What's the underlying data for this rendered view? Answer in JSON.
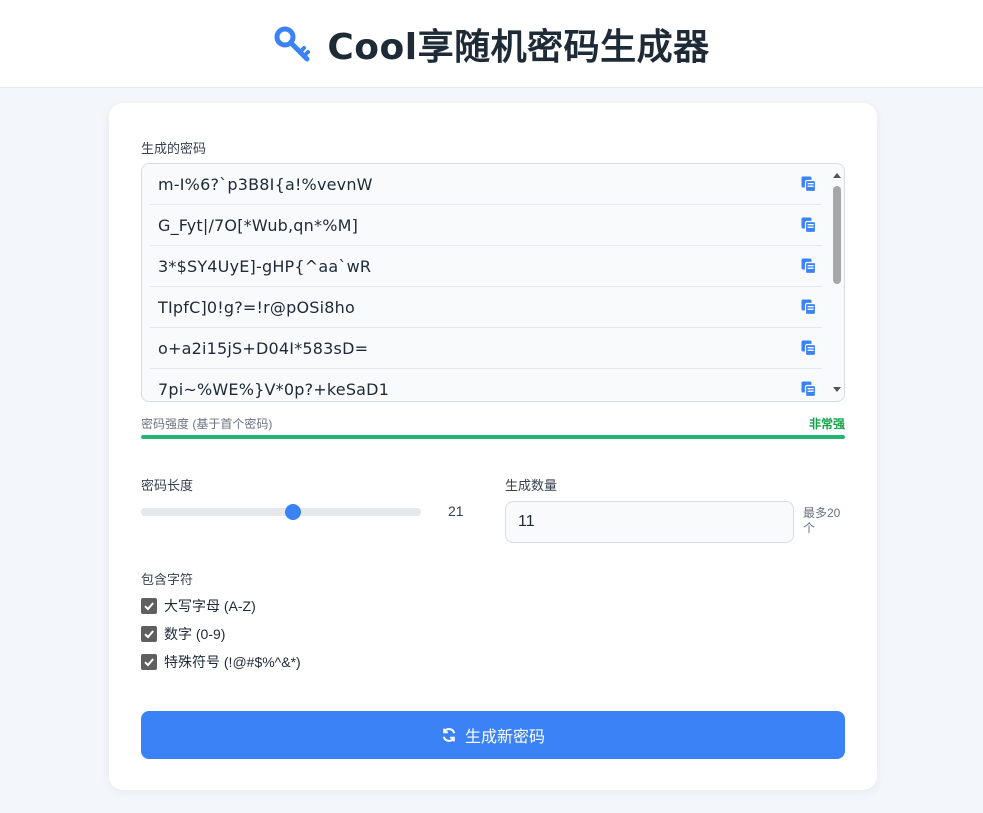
{
  "header": {
    "title": "Cool享随机密码生成器",
    "icon": "key-icon",
    "icon_color": "#3b82f6"
  },
  "generated": {
    "label": "生成的密码",
    "passwords": [
      "m-I%6?`p3B8I{a!%vevnW",
      "G_Fyt|/7O[*Wub,qn*%M]",
      "3*$SY4UyE]-gHP{^aa`wR",
      "TIpfC]0!g?=!r@pOSi8ho",
      "o+a2i15jS+D04I*583sD=",
      "7pi~%WE%}V*0p?+keSaD1"
    ],
    "copy_icon": "copy-icon"
  },
  "strength": {
    "label": "密码强度 (基于首个密码)",
    "value": "非常强",
    "level": 1.0,
    "color": "#22b573"
  },
  "length": {
    "label": "密码长度",
    "value": "21",
    "min": 8,
    "max": 32,
    "current": 21
  },
  "count": {
    "label": "生成数量",
    "value": "11",
    "hint": "最多20个"
  },
  "chars": {
    "label": "包含字符",
    "options": [
      {
        "label": "大写字母 (A-Z)",
        "checked": true
      },
      {
        "label": "数字 (0-9)",
        "checked": true
      },
      {
        "label": "特殊符号 (!@#$%^&*)",
        "checked": true
      }
    ]
  },
  "generate_button": {
    "label": "生成新密码",
    "icon": "refresh-icon",
    "color": "#3b82f6"
  }
}
